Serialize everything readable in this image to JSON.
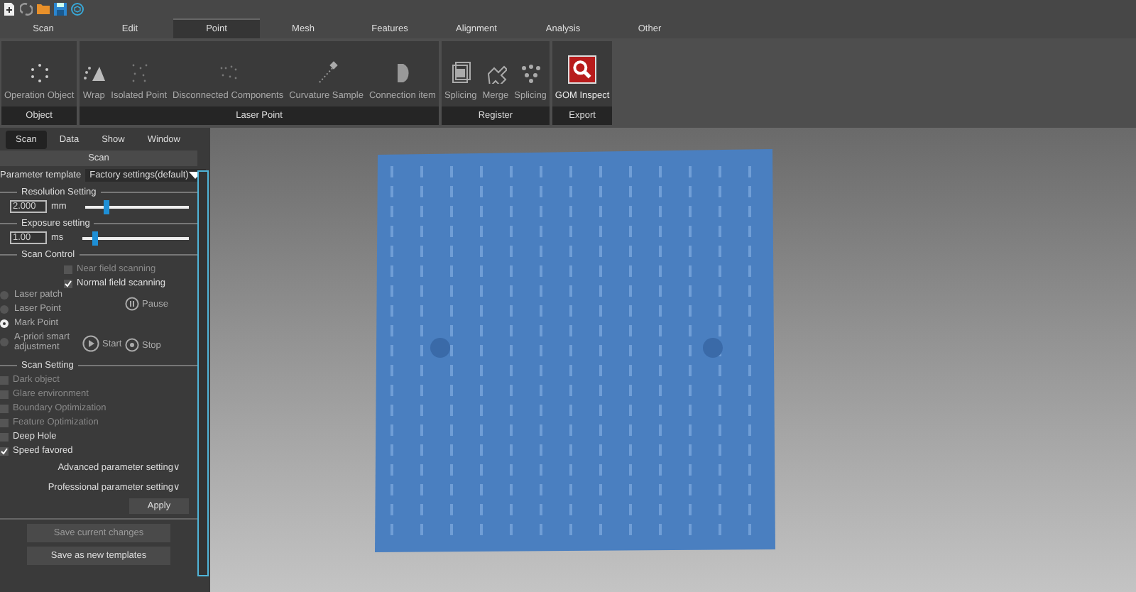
{
  "menu_tabs": [
    {
      "label": "Scan",
      "selected": false
    },
    {
      "label": "Edit",
      "selected": false
    },
    {
      "label": "Point",
      "selected": true
    },
    {
      "label": "Mesh",
      "selected": false
    },
    {
      "label": "Features",
      "selected": false
    },
    {
      "label": "Alignment",
      "selected": false
    },
    {
      "label": "Analysis",
      "selected": false
    },
    {
      "label": "Other",
      "selected": false
    }
  ],
  "ribbon_groups": [
    {
      "title": "Object",
      "items": [
        {
          "label": "Operation Object",
          "kind": "plain"
        }
      ]
    },
    {
      "title": "Laser Point",
      "items": [
        {
          "label": "Wrap",
          "kind": "plain"
        },
        {
          "label": "Isolated Point",
          "kind": "plain"
        },
        {
          "label": "Disconnected Components",
          "kind": "plain"
        },
        {
          "label": "Curvature Sample",
          "kind": "plain"
        },
        {
          "label": "Connection item",
          "kind": "plain"
        }
      ]
    },
    {
      "title": "Register",
      "items": [
        {
          "label": "Splicing",
          "kind": "plain"
        },
        {
          "label": "Merge",
          "kind": "plain"
        },
        {
          "label": "Splicing",
          "kind": "plain"
        }
      ]
    },
    {
      "title": "Export",
      "items": [
        {
          "label": "GOM Inspect",
          "kind": "accent"
        }
      ]
    }
  ],
  "panel_tabs": [
    {
      "label": "Scan",
      "selected": true
    },
    {
      "label": "Data",
      "selected": false
    },
    {
      "label": "Show",
      "selected": false
    },
    {
      "label": "Window",
      "selected": false
    }
  ],
  "panel_title": "Scan",
  "parameter_template": {
    "label": "Parameter template",
    "value": "Factory settings(default)"
  },
  "resolution": {
    "title": "Resolution Setting",
    "value": "2.000",
    "unit": "mm",
    "level": 0.21
  },
  "exposure": {
    "title": "Exposure setting",
    "value": "1.00",
    "unit": "ms",
    "level": 0.12
  },
  "scan_control": {
    "title": "Scan Control",
    "field_options": [
      {
        "label": "Near field scanning",
        "checked": false,
        "disabled": true
      },
      {
        "label": "Normal field scanning",
        "checked": true,
        "disabled": false
      }
    ],
    "modes": [
      {
        "label": "Laser patch",
        "selected": false
      },
      {
        "label": "Laser Point",
        "selected": false
      },
      {
        "label": "Mark Point",
        "selected": true
      },
      {
        "label": "A-priori smart adjustment",
        "selected": false
      }
    ],
    "pause": "Pause",
    "start": "Start",
    "stop": "Stop"
  },
  "scan_setting": {
    "title": "Scan Setting",
    "options": [
      {
        "label": "Dark object",
        "checked": false,
        "disabled": true
      },
      {
        "label": "Glare environment",
        "checked": false,
        "disabled": true
      },
      {
        "label": "Boundary Optimization",
        "checked": false,
        "disabled": true
      },
      {
        "label": "Feature Optimization",
        "checked": false,
        "disabled": true
      },
      {
        "label": "Deep Hole",
        "checked": false,
        "disabled": false
      },
      {
        "label": "Speed favored",
        "checked": true,
        "disabled": false
      }
    ]
  },
  "advanced_link": "Advanced parameter setting∨",
  "professional_link": "Professional parameter setting∨",
  "apply": "Apply",
  "footer_buttons": [
    {
      "label": "Save current changes",
      "disabled": true
    },
    {
      "label": "Save as new templates",
      "disabled": false
    }
  ]
}
